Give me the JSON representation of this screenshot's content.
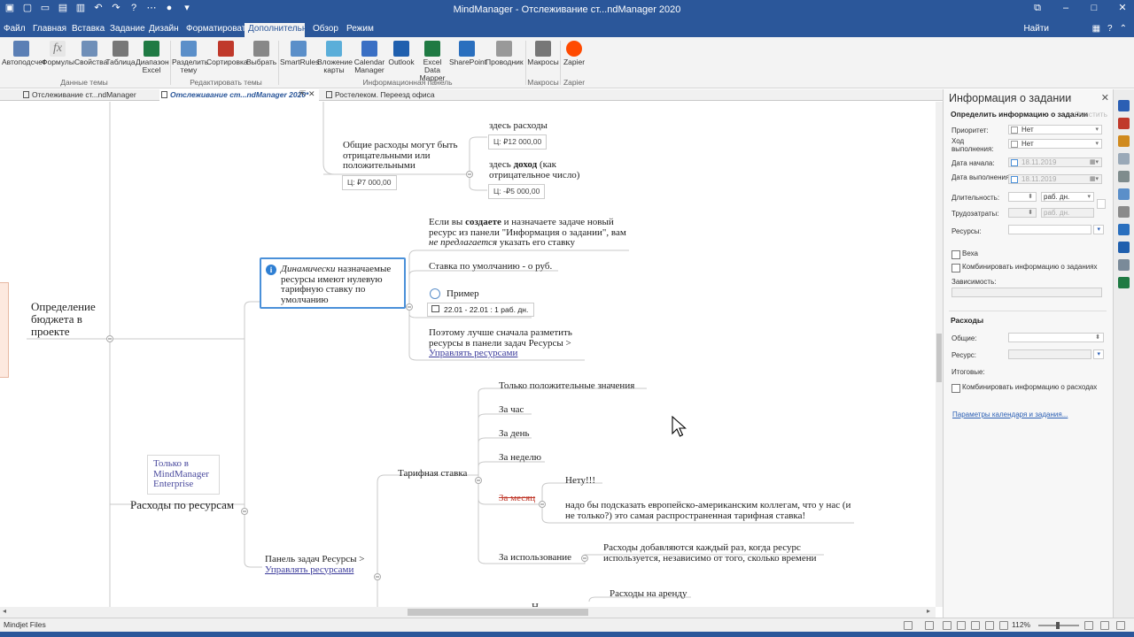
{
  "window": {
    "title": "MindManager - Отслеживание ст...ndManager 2020"
  },
  "ribbon_tabs": [
    "Файл",
    "Главная",
    "Вставка",
    "Задание",
    "Дизайн",
    "Форматировать",
    "Дополнительно",
    "Обзор",
    "Режим"
  ],
  "ribbon_active_tab": "Дополнительно",
  "find_label": "Найти",
  "ribbon": {
    "buttons": [
      {
        "label": "Автоподсчет",
        "color": "#5b7fb5"
      },
      {
        "label": "Формулы",
        "color": "#888888"
      },
      {
        "label": "Свойства",
        "color": "#6f8fb8"
      },
      {
        "label": "Таблица",
        "color": "#777777"
      },
      {
        "label": "Диапазон Excel",
        "color": "#1f7a43"
      },
      {
        "label": "Разделить тему",
        "color": "#5b8fc9"
      },
      {
        "label": "Сортировка",
        "color": "#c0392b"
      },
      {
        "label": "Выбрать",
        "color": "#888888"
      },
      {
        "label": "SmartRules",
        "color": "#5b8fc9"
      },
      {
        "label": "Вложение карты",
        "color": "#5baed9"
      },
      {
        "label": "Calendar Manager",
        "color": "#3a6fc4"
      },
      {
        "label": "Outlook",
        "color": "#1f5fae"
      },
      {
        "label": "Excel Data Mapper",
        "color": "#1f7a43"
      },
      {
        "label": "SharePoint",
        "color": "#2a6fbe"
      },
      {
        "label": "Проводник",
        "color": "#999999"
      },
      {
        "label": "Макросы",
        "color": "#777777"
      },
      {
        "label": "Zapier",
        "color": "#ff4a00"
      }
    ],
    "groups": [
      "Данные темы",
      "Редактировать темы",
      "Информационная панель",
      "Макросы",
      "Zapier"
    ]
  },
  "doc_tabs": [
    {
      "label": "Отслеживание ст...ndManager 2020",
      "active": false
    },
    {
      "label": "Отслеживание ст...ndManager 2020*",
      "active": true
    },
    {
      "label": "Ростелеком. Переезд офиса",
      "active": false
    }
  ],
  "map": {
    "main_topic": "Определение бюджета в проекте",
    "expenses_topic": "Общие расходы могут быть отрицательными или положительными",
    "expenses_cost": "Ц: ₽7 000,00",
    "here_expenses": "здесь расходы",
    "here_expenses_cost": "Ц: ₽12 000,00",
    "here_income_pre": "здесь ",
    "here_income_bold": "доход",
    "here_income_post": " (как отрицательное число)",
    "here_income_cost": "Ц: -₽5 000,00",
    "callout_italic": "Динамически",
    "callout_rest": " назначаемые ресурсы имеют нулевую тарифную ставку по умолчанию",
    "create_a": "Если вы ",
    "create_b": "создаете",
    "create_c": " и назначаете задаче новый ресурс из панели \"Информация о задании\", вам ",
    "create_d": "не предлагается",
    "create_e": " указать его ставку",
    "default_rate": "Ставка по умолчанию - о руб.",
    "example": "Пример",
    "example_task": "22.01 - 22.01 : 1 раб. дн.",
    "better_text": "Поэтому лучше сначала разметить ресурсы в панели задач Ресурсы > ",
    "manage_resources": "Управлять ресурсами",
    "enterprise_only": "Только в MindManager Enterprise",
    "resource_costs": "Расходы по ресурсам",
    "panel_path": "Панель задач Ресурсы > ",
    "rate_topic": "Тарифная ставка",
    "positive_only": "Только положительные значения",
    "per_hour": "За час",
    "per_day": "За день",
    "per_week": "За неделю",
    "per_month": "За месяц",
    "no_excl": "Нету!!!",
    "hint": "надо бы подсказать европейско-американским коллегам, что у нас (и не только?) это самая распространенная тарифная ставка!",
    "per_use": "За использование",
    "per_use_desc": "Расходы добавляются каждый раз, когда ресурс используется, независимо от того, сколько времени",
    "rent_costs": "Расходы на аренду",
    "cut_letter": "Н"
  },
  "task_panel": {
    "title": "Информация о задании",
    "subtitle": "Определить информацию о задании",
    "clear": "Очистить",
    "priority_label": "Приоритет:",
    "priority_value": "Нет",
    "progress_label": "Ход выполнения:",
    "progress_value": "Нет",
    "start_label": "Дата начала:",
    "start_value": "18.11.2019",
    "due_label": "Дата выполнения:",
    "due_value": "18.11.2019",
    "duration_label": "Длительность:",
    "duration_unit": "раб. дн.",
    "effort_label": "Трудозатраты:",
    "effort_unit": "раб. дн.",
    "resources_label": "Ресурсы:",
    "milestone": "Веха",
    "combine_tasks": "Комбинировать информацию о заданиях",
    "dependency_label": "Зависимость:",
    "costs_section": "Расходы",
    "total_label": "Общие:",
    "resource_label": "Ресурс:",
    "final_label": "Итоговые:",
    "combine_costs": "Комбинировать информацию о расходах",
    "calendar_link": "Параметры календаря и задания..."
  },
  "status": {
    "left": "Mindjet Files",
    "zoom": "112%"
  }
}
